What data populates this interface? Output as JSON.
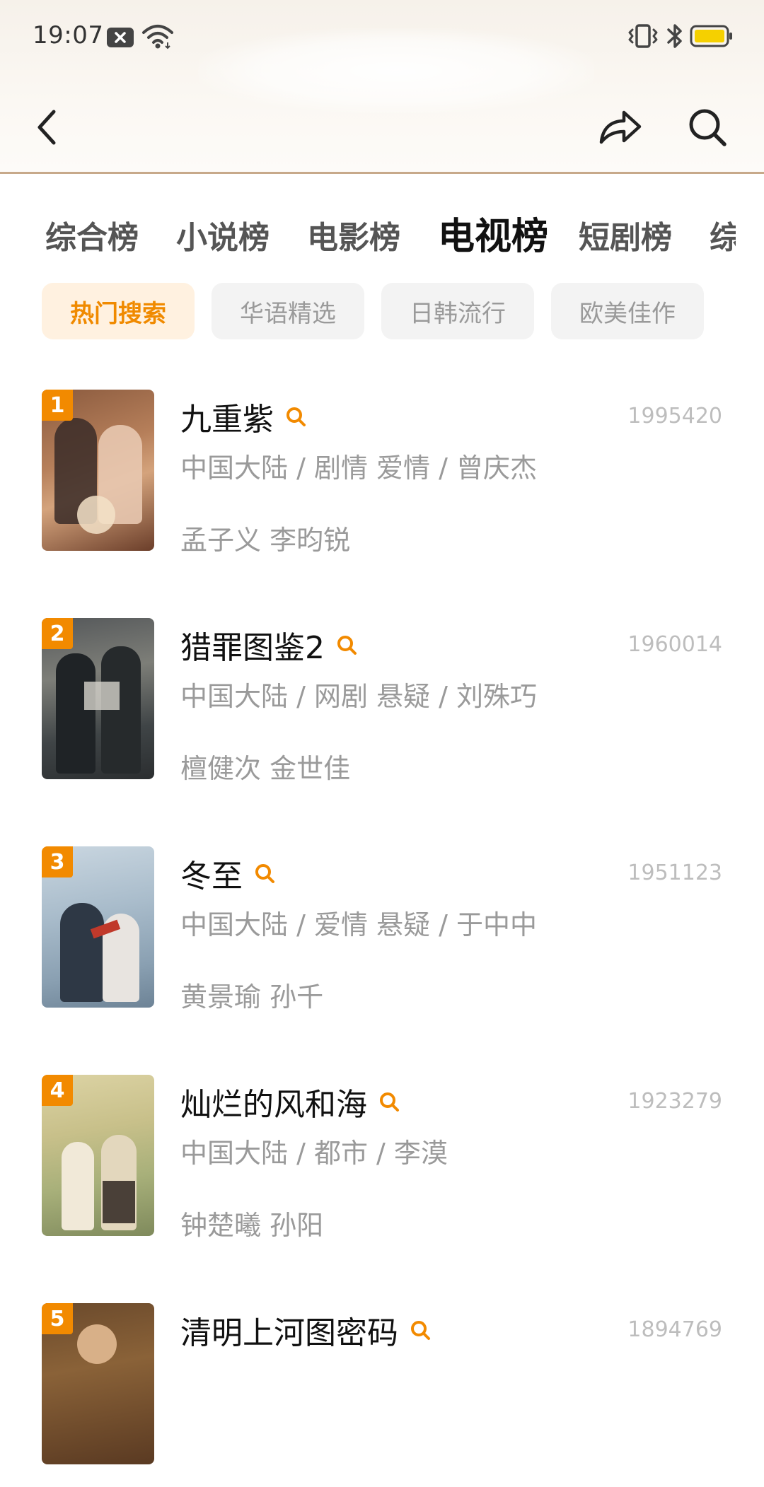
{
  "status_bar": {
    "time": "19:07"
  },
  "nav": {
    "back_icon": "chevron-left-icon",
    "share_icon": "share-icon",
    "search_icon": "search-icon"
  },
  "tabs": [
    {
      "label": "综合榜",
      "active": false
    },
    {
      "label": "小说榜",
      "active": false
    },
    {
      "label": "电影榜",
      "active": false
    },
    {
      "label": "电视榜",
      "active": true
    },
    {
      "label": "短剧榜",
      "active": false
    },
    {
      "label": "综",
      "active": false
    }
  ],
  "filters": [
    {
      "label": "热门搜索",
      "active": true
    },
    {
      "label": "华语精选",
      "active": false
    },
    {
      "label": "日韩流行",
      "active": false
    },
    {
      "label": "欧美佳作",
      "active": false
    }
  ],
  "items": [
    {
      "rank": "1",
      "title": "九重紫",
      "heat": "1995420",
      "meta": "中国大陆 / 剧情 爱情 / 曾庆杰",
      "cast": "孟子义 李昀锐"
    },
    {
      "rank": "2",
      "title": "猎罪图鉴2",
      "heat": "1960014",
      "meta": "中国大陆 / 网剧 悬疑 / 刘殊巧",
      "cast": "檀健次 金世佳"
    },
    {
      "rank": "3",
      "title": "冬至",
      "heat": "1951123",
      "meta": "中国大陆 / 爱情 悬疑 / 于中中",
      "cast": "黄景瑜 孙千"
    },
    {
      "rank": "4",
      "title": "灿烂的风和海",
      "heat": "1923279",
      "meta": "中国大陆 / 都市 / 李漠",
      "cast": "钟楚曦 孙阳"
    },
    {
      "rank": "5",
      "title": "清明上河图密码",
      "heat": "1894769",
      "meta": "",
      "cast": ""
    }
  ],
  "colors": {
    "accent": "#f28a00",
    "chip_active_bg": "#fff1e0",
    "header_divider": "#c7a98a",
    "battery": "#f5d000"
  }
}
